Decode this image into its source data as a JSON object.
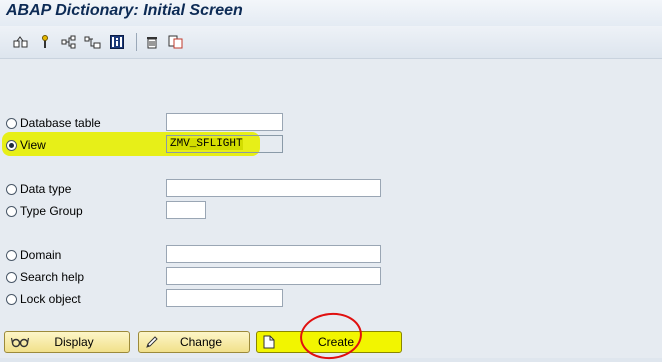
{
  "window": {
    "title": "ABAP Dictionary: Initial Screen"
  },
  "toolbar": {
    "icons": [
      "other-object-icon",
      "where-used-icon",
      "hierarchy-icon",
      "display-object-list-icon",
      "info-icon",
      "delete-icon",
      "copy-icon"
    ]
  },
  "objects": [
    {
      "label": "Database table",
      "value": "",
      "selected": false
    },
    {
      "label": "View",
      "value": "ZMV_SFLIGHT",
      "selected": true
    },
    {
      "label": "Data type",
      "value": "",
      "selected": false
    },
    {
      "label": "Type Group",
      "value": "",
      "selected": false
    },
    {
      "label": "Domain",
      "value": "",
      "selected": false
    },
    {
      "label": "Search help",
      "value": "",
      "selected": false
    },
    {
      "label": "Lock object",
      "value": "",
      "selected": false
    }
  ],
  "buttons": {
    "display": "Display",
    "change": "Change",
    "create": "Create"
  },
  "colors": {
    "highlight": "#e7f000",
    "annotation": "#e01010",
    "button_bg": "#f1e08a"
  }
}
